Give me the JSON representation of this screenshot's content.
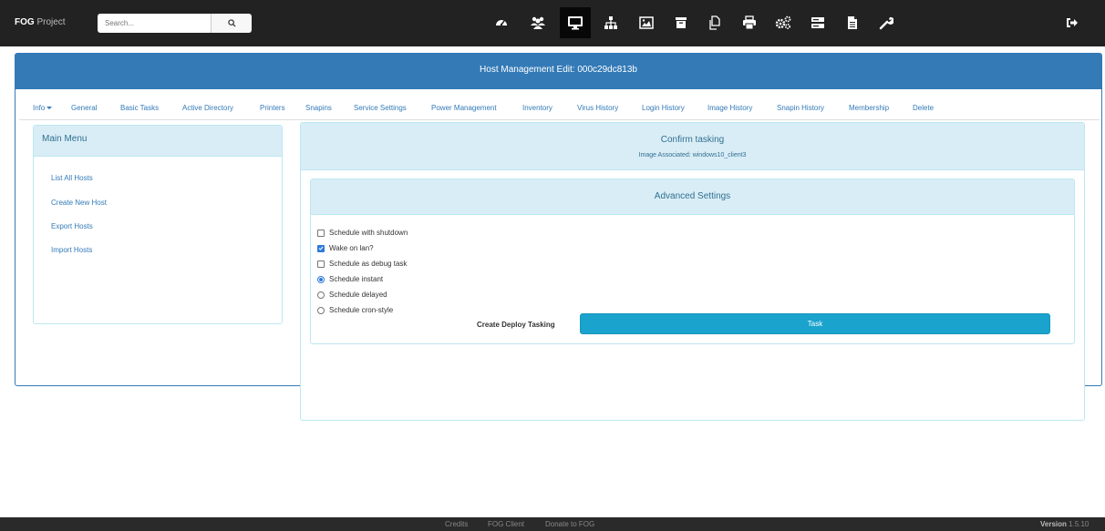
{
  "navbar": {
    "brand_bold": "FOG",
    "brand_rest": "Project",
    "search_placeholder": "Search...",
    "icons": [
      "dashboard-icon",
      "users-icon",
      "desktop-icon",
      "sitemap-icon",
      "image-icon",
      "archive-icon",
      "copy-icon",
      "print-icon",
      "cogs-icon",
      "hdd-icon",
      "file-icon",
      "wrench-icon"
    ],
    "active_icon": "desktop-icon",
    "logout_icon": "sign-out-icon"
  },
  "panel": {
    "title": "Host Management Edit: 000c29dc813b"
  },
  "tabs": [
    {
      "label": "Info"
    },
    {
      "label": "General"
    },
    {
      "label": "Basic Tasks"
    },
    {
      "label": "Active Directory"
    },
    {
      "label": "Printers"
    },
    {
      "label": "Snapins"
    },
    {
      "label": "Service Settings"
    },
    {
      "label": "Power Management"
    },
    {
      "label": "Inventory"
    },
    {
      "label": "Virus History"
    },
    {
      "label": "Login History"
    },
    {
      "label": "Image History"
    },
    {
      "label": "Snapin History"
    },
    {
      "label": "Membership"
    },
    {
      "label": "Delete"
    }
  ],
  "main_menu": {
    "title": "Main Menu",
    "items": [
      {
        "label": "List All Hosts"
      },
      {
        "label": "Create New Host"
      },
      {
        "label": "Export Hosts"
      },
      {
        "label": "Import Hosts"
      }
    ]
  },
  "confirm": {
    "title": "Confirm tasking",
    "subtitle": "Image Associated: windows10_client3"
  },
  "advanced": {
    "title": "Advanced Settings",
    "options": [
      {
        "label": "Schedule with shutdown",
        "type": "checkbox",
        "checked": false
      },
      {
        "label": "Wake on lan?",
        "type": "checkbox",
        "checked": true
      },
      {
        "label": "Schedule as debug task",
        "type": "checkbox",
        "checked": false
      },
      {
        "label": "Schedule instant",
        "type": "radio",
        "checked": true
      },
      {
        "label": "Schedule delayed",
        "type": "radio",
        "checked": false
      },
      {
        "label": "Schedule cron-style",
        "type": "radio",
        "checked": false
      }
    ],
    "deploy_label": "Create Deploy Tasking",
    "task_button": "Task"
  },
  "footer": {
    "links": [
      {
        "label": "Credits"
      },
      {
        "label": "FOG Client"
      },
      {
        "label": "Donate to FOG"
      }
    ],
    "version_label": "Version",
    "version_value": "1.5.10"
  },
  "colors": {
    "navbar": "#222222",
    "primary": "#337ab7",
    "info_bg": "#d9edf7",
    "info_text": "#31708f",
    "task_button": "#1aa3cc"
  }
}
